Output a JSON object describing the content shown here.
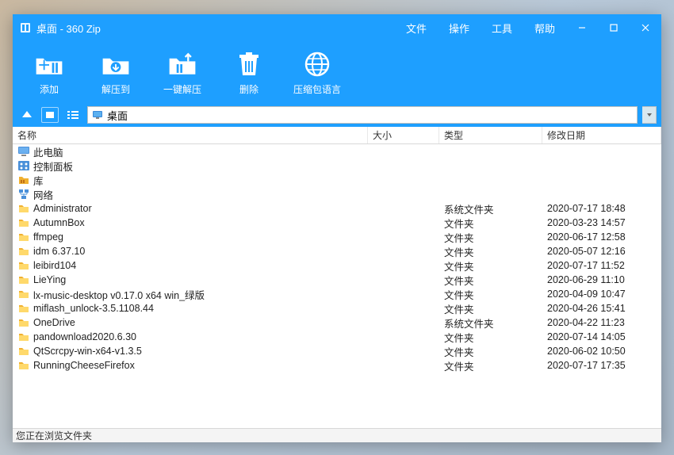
{
  "title": "桌面 - 360 Zip",
  "menu": {
    "file": "文件",
    "action": "操作",
    "tools": "工具",
    "help": "帮助"
  },
  "toolbar": {
    "add": "添加",
    "extract_to": "解压到",
    "one_click_extract": "一键解压",
    "delete": "删除",
    "lang": "压缩包语言"
  },
  "path": "桌面",
  "columns": {
    "name": "名称",
    "size": "大小",
    "type": "类型",
    "date": "修改日期"
  },
  "rows": [
    {
      "icon": "computer",
      "name": "此电脑",
      "size": "",
      "type": "",
      "date": ""
    },
    {
      "icon": "control",
      "name": "控制面板",
      "size": "",
      "type": "",
      "date": ""
    },
    {
      "icon": "library",
      "name": "库",
      "size": "",
      "type": "",
      "date": ""
    },
    {
      "icon": "network",
      "name": "网络",
      "size": "",
      "type": "",
      "date": ""
    },
    {
      "icon": "folder",
      "name": "Administrator",
      "size": "",
      "type": "系统文件夹",
      "date": "2020-07-17 18:48"
    },
    {
      "icon": "folder",
      "name": "AutumnBox",
      "size": "",
      "type": "文件夹",
      "date": "2020-03-23 14:57"
    },
    {
      "icon": "folder",
      "name": "ffmpeg",
      "size": "",
      "type": "文件夹",
      "date": "2020-06-17 12:58"
    },
    {
      "icon": "folder",
      "name": "idm 6.37.10",
      "size": "",
      "type": "文件夹",
      "date": "2020-05-07 12:16"
    },
    {
      "icon": "folder",
      "name": "leibird104",
      "size": "",
      "type": "文件夹",
      "date": "2020-07-17 11:52"
    },
    {
      "icon": "folder",
      "name": "LieYing",
      "size": "",
      "type": "文件夹",
      "date": "2020-06-29 11:10"
    },
    {
      "icon": "folder",
      "name": "lx-music-desktop v0.17.0 x64 win_绿版",
      "size": "",
      "type": "文件夹",
      "date": "2020-04-09 10:47"
    },
    {
      "icon": "folder",
      "name": "miflash_unlock-3.5.1108.44",
      "size": "",
      "type": "文件夹",
      "date": "2020-04-26 15:41"
    },
    {
      "icon": "folder",
      "name": "OneDrive",
      "size": "",
      "type": "系统文件夹",
      "date": "2020-04-22 11:23"
    },
    {
      "icon": "folder",
      "name": "pandownload2020.6.30",
      "size": "",
      "type": "文件夹",
      "date": "2020-07-14 14:05"
    },
    {
      "icon": "folder",
      "name": "QtScrcpy-win-x64-v1.3.5",
      "size": "",
      "type": "文件夹",
      "date": "2020-06-02 10:50"
    },
    {
      "icon": "folder",
      "name": "RunningCheeseFirefox",
      "size": "",
      "type": "文件夹",
      "date": "2020-07-17 17:35"
    }
  ],
  "statusbar": "您正在浏览文件夹",
  "colors": {
    "accent": "#1e9fff"
  }
}
